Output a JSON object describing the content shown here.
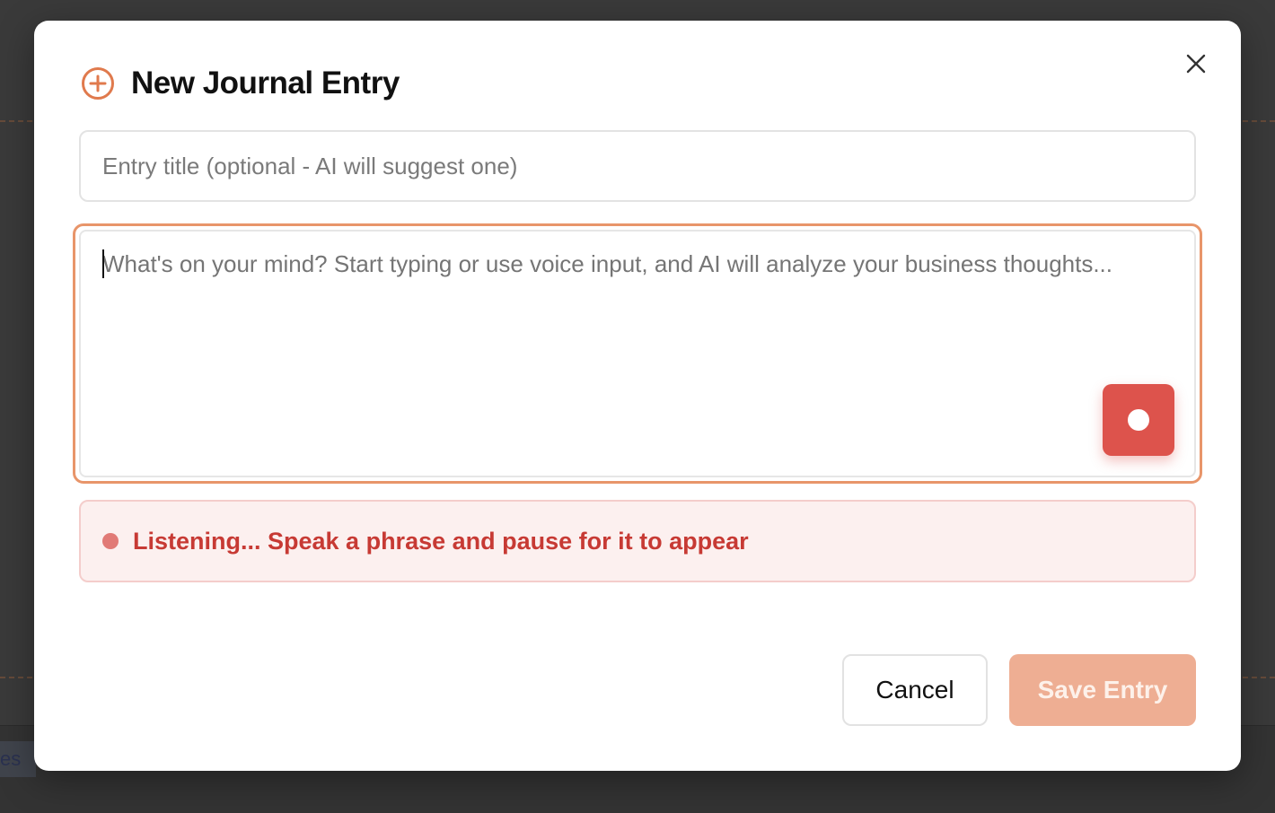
{
  "background": {
    "partial_chip_text": "es"
  },
  "modal": {
    "title": "New Journal Entry",
    "icons": {
      "title_icon": "plus-circle-icon",
      "close_icon": "close-icon",
      "record_icon": "record-dot-icon",
      "status_icon": "status-dot-icon"
    },
    "title_input": {
      "value": "",
      "placeholder": "Entry title (optional - AI will suggest one)"
    },
    "entry_textarea": {
      "value": "",
      "placeholder": "What's on your mind? Start typing or use voice input, and AI will analyze your business thoughts..."
    },
    "status": {
      "text": "Listening... Speak a phrase and pause for it to appear"
    },
    "buttons": {
      "cancel_label": "Cancel",
      "save_label": "Save Entry"
    }
  },
  "colors": {
    "accent": "#e07a4d",
    "focus_border": "#e8956a",
    "record": "#dd534c",
    "status_text": "#c73a34",
    "status_bg": "#fcf0ef",
    "save_disabled": "#eeae93"
  }
}
